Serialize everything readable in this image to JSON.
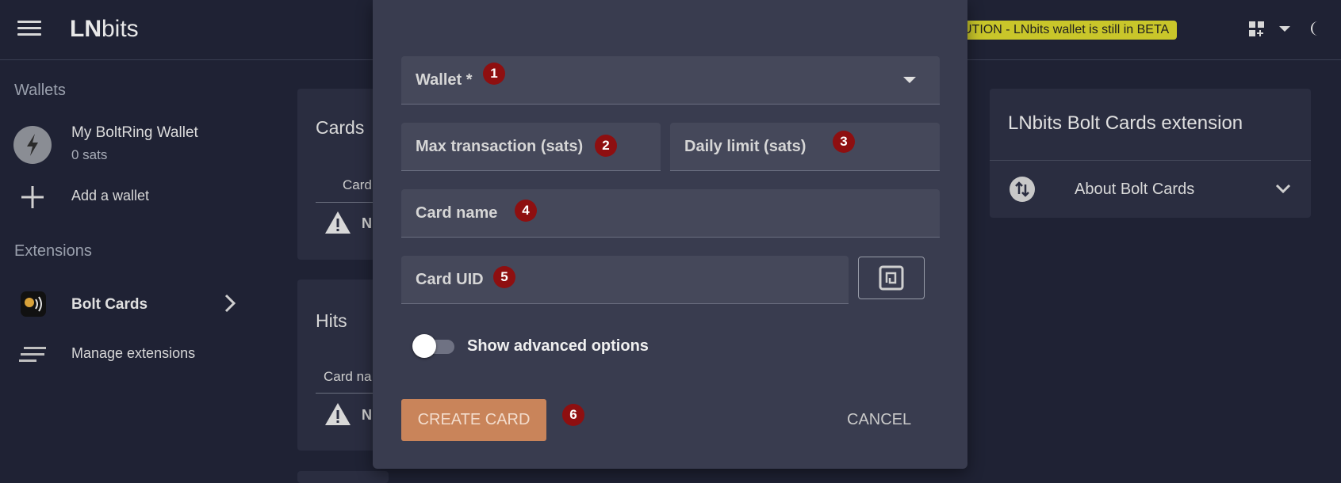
{
  "header": {
    "brand_bold": "LN",
    "brand_rest": "bits",
    "beta_text": "UTION - LNbits wallet is still in BETA"
  },
  "sidebar": {
    "wallets_heading": "Wallets",
    "wallet_name": "My BoltRing Wallet",
    "wallet_balance": "0 sats",
    "add_wallet": "Add a wallet",
    "extensions_heading": "Extensions",
    "extension_label": "Bolt Cards",
    "manage_extensions": "Manage extensions"
  },
  "background": {
    "cards_title": "Cards",
    "cards_col": "Card",
    "cards_empty": "N",
    "hits_title": "Hits",
    "hits_col": "Card na",
    "hits_empty": "N"
  },
  "right_panel": {
    "title": "LNbits Bolt Cards extension",
    "about_label": "About Bolt Cards"
  },
  "dialog": {
    "wallet_label": "Wallet *",
    "max_tx_label": "Max transaction (sats)",
    "daily_limit_label": "Daily limit (sats)",
    "card_name_label": "Card name",
    "card_uid_label": "Card UID",
    "advanced_label": "Show advanced options",
    "create_button": "CREATE CARD",
    "cancel_button": "CANCEL",
    "markers": [
      "1",
      "2",
      "3",
      "4",
      "5",
      "6"
    ]
  },
  "colors": {
    "background": "#1f2234",
    "dialog": "#393c4f",
    "field": "#45485a",
    "beta_banner": "#c9c62a",
    "create_button": "#c9845a",
    "marker": "#8e0f10"
  },
  "icons": [
    "menu-icon",
    "grid-icon",
    "caret-icon",
    "moon-icon",
    "bolt-icon",
    "plus-icon",
    "chevron-right-icon",
    "manage-icon",
    "warning-icon",
    "swap-icon",
    "chevron-down-icon",
    "nfc-icon"
  ]
}
